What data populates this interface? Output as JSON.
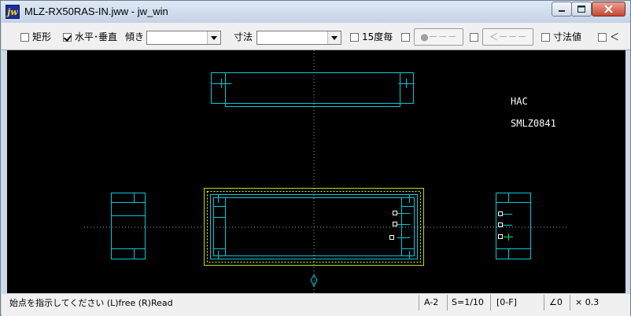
{
  "window": {
    "title": "MLZ-RX50RAS-IN.jww - jw_win",
    "app_icon_text": "jw"
  },
  "toolbar": {
    "rect_label": "矩形",
    "rect_checked": false,
    "hv_label": "水平･垂直",
    "hv_checked": true,
    "tilt_label": "傾き",
    "tilt_value": "",
    "dim_label": "寸法",
    "dim_value": "",
    "deg15_label": "15度毎",
    "deg15_checked": false,
    "btn1_label": "●－－－",
    "btn2_label": "＜－－－",
    "dimval_label": "寸法値",
    "last_label": "＜"
  },
  "drawing": {
    "label_hac": "HAC",
    "label_model": "SMLZ0841"
  },
  "colors": {
    "line": "#00c8d8",
    "green": "#b4e000",
    "yellow": "#f0f000",
    "white": "#ffffff"
  },
  "status": {
    "message": "始点を指示してください (L)free (R)Read",
    "layer": "A-2",
    "scale": "S=1/10",
    "group": "[0-F]",
    "angle": "∠0",
    "factor": "× 0.3"
  }
}
